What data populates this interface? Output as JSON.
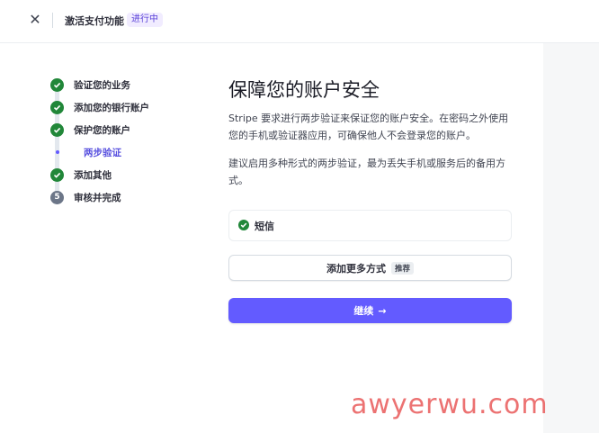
{
  "topbar": {
    "close_icon": "close-icon",
    "title": "激活支付功能",
    "status": "进行中"
  },
  "steps": [
    {
      "label": "验证您的业务",
      "state": "done"
    },
    {
      "label": "添加您的银行账户",
      "state": "done"
    },
    {
      "label": "保护您的账户",
      "state": "done"
    },
    {
      "label": "两步验证",
      "state": "current-substep"
    },
    {
      "label": "添加其他",
      "state": "done"
    },
    {
      "label": "审核并完成",
      "state": "pending",
      "number": "5"
    }
  ],
  "main": {
    "title": "保障您的账户安全",
    "description": "Stripe 要求进行两步验证来保证您的账户安全。在密码之外使用您的手机或验证器应用，可确保他人不会登录您的账户。",
    "recommendation": "建议启用多种形式的两步验证，最为丢失手机或服务后的备用方式。",
    "method": {
      "label": "短信",
      "icon": "check-circle-icon"
    },
    "add_button": {
      "label": "添加更多方式",
      "badge": "推荐"
    },
    "continue_button": {
      "label": "继续",
      "icon": "arrow-right-icon",
      "arrow": "→"
    }
  },
  "watermark": "awyerwu.com",
  "colors": {
    "accent": "#635bff",
    "success": "#218739",
    "badge_bg": "#f1ecff",
    "badge_text": "#5b43d9"
  }
}
